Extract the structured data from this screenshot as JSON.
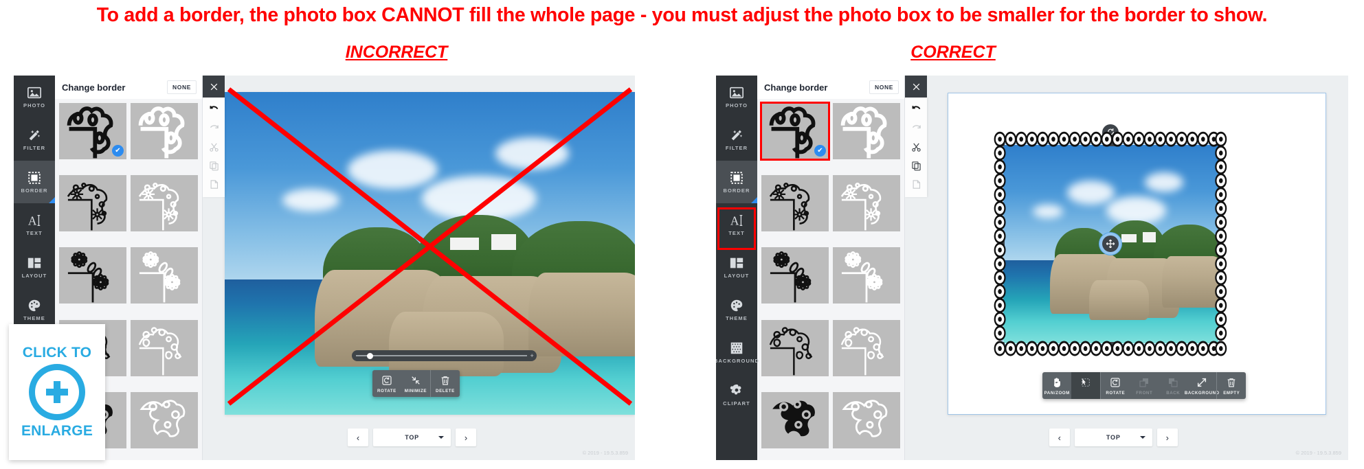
{
  "annotation": {
    "title": "To add a border, the photo box CANNOT fill the whole page - you must adjust the photo box to be smaller for the border to show.",
    "incorrect_label": "INCORRECT",
    "correct_label": "CORRECT",
    "accent_color": "#ff0000"
  },
  "enlarge_badge": {
    "line1": "CLICK TO",
    "line2": "ENLARGE",
    "icon": "plus-circle-icon",
    "color": "#29abe2"
  },
  "rail": {
    "items": [
      {
        "label": "PHOTO",
        "icon": "photo-icon",
        "active": false
      },
      {
        "label": "FILTER",
        "icon": "magic-wand-icon",
        "active": false
      },
      {
        "label": "BORDER",
        "icon": "border-icon",
        "active": true
      },
      {
        "label": "TEXT",
        "icon": "text-icon",
        "active": false
      },
      {
        "label": "LAYOUT",
        "icon": "layout-icon",
        "active": false
      },
      {
        "label": "THEME",
        "icon": "palette-icon",
        "active": false
      },
      {
        "label": "BACKGROUND",
        "icon": "grid-icon",
        "active": false
      },
      {
        "label": "CLIPART",
        "icon": "flower-icon",
        "active": false
      }
    ]
  },
  "panel": {
    "title": "Change border",
    "none_label": "NONE",
    "close_icon": "close-icon",
    "thumbnails": [
      {
        "id": "blob-dark",
        "style": "dark",
        "pattern": "blob",
        "selected": true
      },
      {
        "id": "blob-light",
        "style": "light",
        "pattern": "blob",
        "selected": false
      },
      {
        "id": "daisy-dark",
        "style": "dark",
        "pattern": "daisy",
        "selected": false
      },
      {
        "id": "daisy-light",
        "style": "light",
        "pattern": "daisy",
        "selected": false
      },
      {
        "id": "petal-dark",
        "style": "dark",
        "pattern": "petal",
        "selected": false
      },
      {
        "id": "petal-light",
        "style": "light",
        "pattern": "petal",
        "selected": false
      },
      {
        "id": "lace-dark",
        "style": "dark",
        "pattern": "lace",
        "selected": false
      },
      {
        "id": "lace-light",
        "style": "light",
        "pattern": "lace",
        "selected": false
      },
      {
        "id": "vine-dark",
        "style": "dark",
        "pattern": "vine",
        "selected": false
      },
      {
        "id": "vine-light",
        "style": "light",
        "pattern": "vine",
        "selected": false
      }
    ]
  },
  "edit_strip": {
    "buttons": [
      {
        "label": "Undo",
        "icon": "undo-icon",
        "enabled": true
      },
      {
        "label": "Redo",
        "icon": "redo-icon",
        "enabled": false
      },
      {
        "label": "Cut",
        "icon": "scissors-icon",
        "enabled": false
      },
      {
        "label": "Copy",
        "icon": "copy-icon",
        "enabled": false
      },
      {
        "label": "Paste",
        "icon": "paste-icon",
        "enabled": false
      }
    ]
  },
  "left_app": {
    "toolbar": [
      {
        "label": "ROTATE",
        "icon": "rotate-icon",
        "state": "normal"
      },
      {
        "label": "MINIMIZE",
        "icon": "minimize-icon",
        "state": "normal"
      },
      {
        "label": "DELETE",
        "icon": "trash-icon",
        "state": "normal"
      }
    ],
    "zoom_slider": {
      "value": 8
    }
  },
  "right_app": {
    "toolbar": [
      {
        "label": "PAN/ZOOM",
        "icon": "hand-icon",
        "state": "normal"
      },
      {
        "label": "",
        "icon": "select-icon",
        "state": "active"
      },
      {
        "label": "ROTATE",
        "icon": "rotate-icon",
        "state": "normal"
      },
      {
        "label": "FRONT",
        "icon": "front-icon",
        "state": "disabled"
      },
      {
        "label": "BACK",
        "icon": "back-icon",
        "state": "disabled"
      },
      {
        "label": "BACKGROUND",
        "icon": "expand-icon",
        "state": "normal"
      },
      {
        "label": "EMPTY",
        "icon": "trash-icon",
        "state": "normal"
      }
    ],
    "rotate_handle_icon": "rotate-handle-icon",
    "move_handle_icon": "move-handle-icon"
  },
  "page_nav": {
    "prev_icon": "chevron-left-icon",
    "next_icon": "chevron-right-icon",
    "selected_page": "TOP",
    "caret_icon": "caret-down-icon"
  },
  "status": {
    "copyright": "© 2019 - 19.5.3.859"
  }
}
